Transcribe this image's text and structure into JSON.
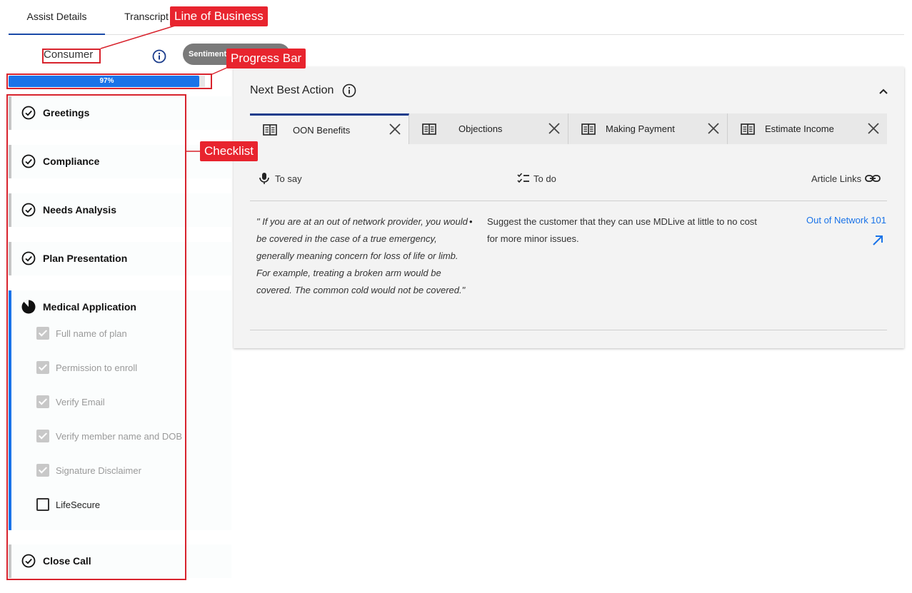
{
  "tabs": [
    {
      "label": "Assist Details",
      "active": true
    },
    {
      "label": "Transcript",
      "active": false
    }
  ],
  "line_of_business": "Consumer",
  "sentiment": {
    "label": "Sentiment"
  },
  "progress": {
    "percent": 97,
    "label": "97%",
    "color": "#1a73e8"
  },
  "checklist": {
    "sections": [
      {
        "title": "Greetings",
        "status": "complete"
      },
      {
        "title": "Compliance",
        "status": "complete"
      },
      {
        "title": "Needs Analysis",
        "status": "complete"
      },
      {
        "title": "Plan Presentation",
        "status": "complete"
      },
      {
        "title": "Medical Application",
        "status": "in-progress"
      },
      {
        "title": "Close Call",
        "status": "complete"
      }
    ],
    "medical_items": [
      {
        "label": "Full name of plan",
        "checked": true
      },
      {
        "label": "Permission to enroll",
        "checked": true
      },
      {
        "label": "Verify Email",
        "checked": true
      },
      {
        "label": "Verify member name and DOB",
        "checked": true
      },
      {
        "label": "Signature Disclaimer",
        "checked": true
      },
      {
        "label": "LifeSecure",
        "checked": false
      }
    ]
  },
  "next_best_action": {
    "title": "Next Best Action",
    "tabs": [
      {
        "label": "OON Benefits",
        "active": true
      },
      {
        "label": "Objections",
        "active": false
      },
      {
        "label": "Making Payment",
        "active": false
      },
      {
        "label": "Estimate Income",
        "active": false
      }
    ],
    "columns": {
      "to_say": "To say",
      "to_do": "To do",
      "article_links": "Article Links"
    },
    "to_say_text": "\" If you are at an out of network provider, you would be covered in the case of a true emergency, generally meaning concern for loss of life or limb. For example, treating a broken arm would be covered. The common cold would not be covered.\"",
    "to_do_items": [
      "Suggest the customer that they can use MDLive at little to no cost for more minor issues."
    ],
    "article_link": "Out of Network 101"
  },
  "annotations": {
    "line_of_business": "Line of Business",
    "progress_bar": "Progress Bar",
    "checklist": "Checklist"
  },
  "colors": {
    "accent": "#1a73e8",
    "annotation": "#e8242e",
    "nav_underline": "#1a4aa8"
  }
}
